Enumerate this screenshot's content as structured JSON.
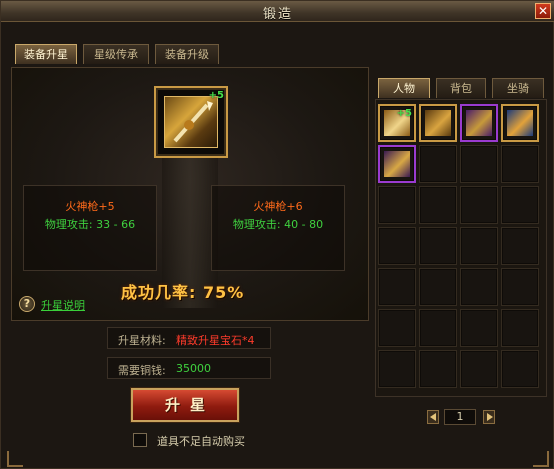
{
  "window": {
    "title": "锻造"
  },
  "tabs_main": [
    {
      "label": "装备升星",
      "active": true
    },
    {
      "label": "星级传承",
      "active": false
    },
    {
      "label": "装备升级",
      "active": false
    }
  ],
  "tabs_side": [
    {
      "label": "人物",
      "active": true
    },
    {
      "label": "背包",
      "active": false
    },
    {
      "label": "坐骑",
      "active": false
    }
  ],
  "main_item": {
    "badge": "+5",
    "icon": "gold-spear-icon"
  },
  "current": {
    "name": "火神枪+5",
    "stat": "物理攻击: 33 - 66"
  },
  "next": {
    "name": "火神枪+6",
    "stat": "物理攻击: 40 - 80"
  },
  "success_rate": "成功几率: 75%",
  "help": {
    "icon": "?",
    "link": "升星说明"
  },
  "materials": {
    "label": "升星材料:",
    "value": "精致升星宝石*4",
    "value_color": "#ff3b2b"
  },
  "cost": {
    "label": "需要铜钱:",
    "value": "35000",
    "value_color": "#3fd13f"
  },
  "upgrade_button": "升星",
  "auto_buy": {
    "label": "道具不足自动购买",
    "checked": false
  },
  "inventory": {
    "items": [
      {
        "icon": "gold-spear-icon",
        "frame": "gold",
        "badge": "+5"
      },
      {
        "icon": "gold-claw-icon",
        "frame": "gold",
        "badge": ""
      },
      {
        "icon": "purple-helmet-icon",
        "frame": "purple",
        "badge": ""
      },
      {
        "icon": "blue-helmet-icon",
        "frame": "gold",
        "badge": ""
      },
      {
        "icon": "purple-gauntlet-icon",
        "frame": "purple",
        "badge": ""
      }
    ]
  },
  "pager": {
    "page": "1"
  },
  "colors": {
    "accent_gold": "#c99a45",
    "rarity_purple": "#9a3bd0",
    "name_orange": "#ff6a1a",
    "stat_green": "#3fd13f"
  }
}
